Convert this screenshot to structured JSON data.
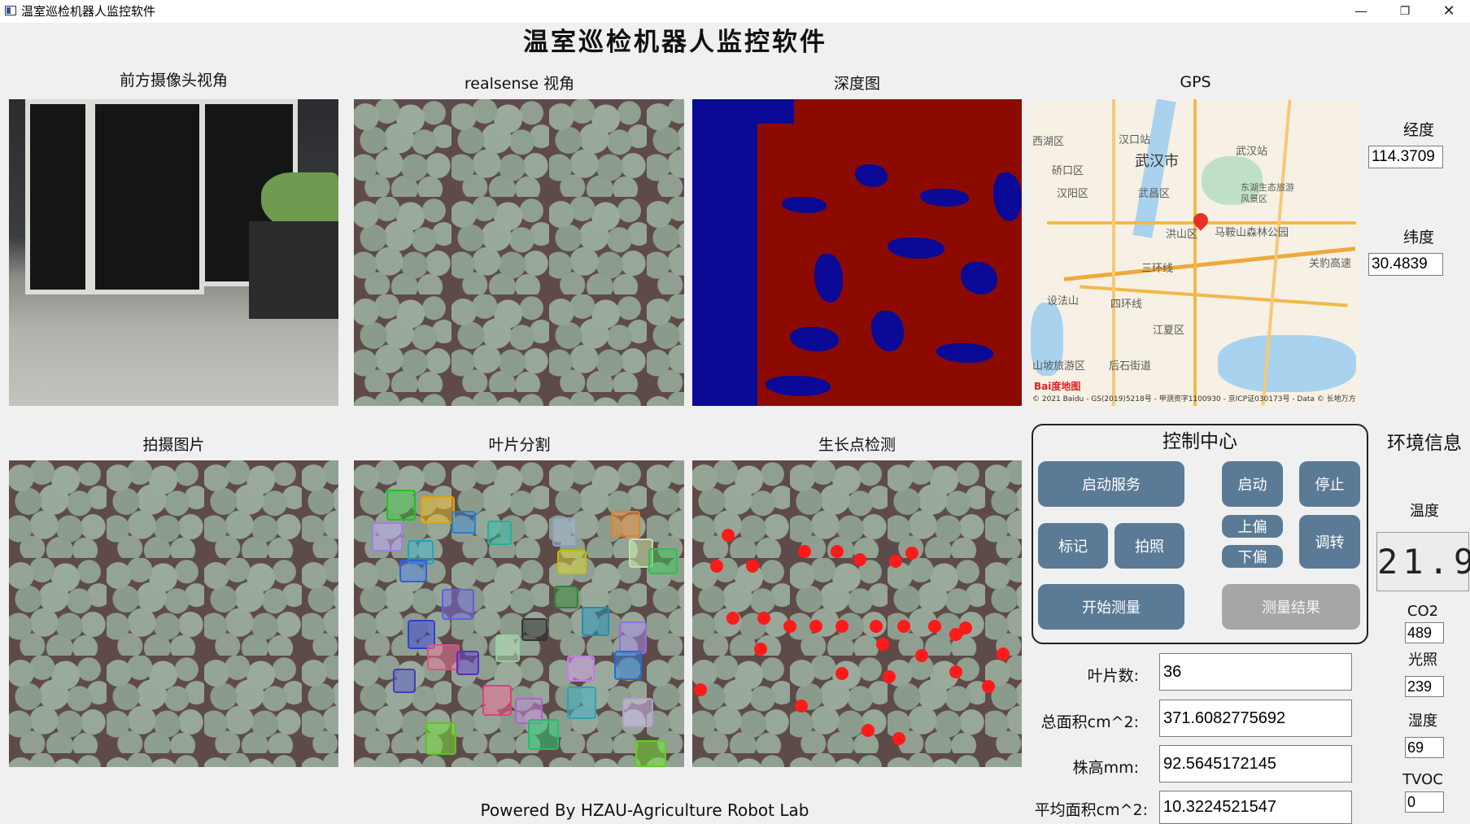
{
  "window": {
    "title": "温室巡检机器人监控软件",
    "minimize": "—",
    "maximize": "❐",
    "close": "✕"
  },
  "main_title": "温室巡检机器人监控软件",
  "views": {
    "front_camera": "前方摄像头视角",
    "realsense": "realsense 视角",
    "depth": "深度图",
    "gps": "GPS",
    "captured": "拍摄图片",
    "leaf_segmentation": "叶片分割",
    "growth_point": "生长点检测"
  },
  "map": {
    "city": "武汉市",
    "labels": [
      "西湖区",
      "汉口站",
      "硚口区",
      "汉阳区",
      "武昌区",
      "武汉站",
      "洪山区",
      "东湖生态旅游风景区",
      "马鞍山森林公园",
      "三环线",
      "四环线",
      "江夏区",
      "设法山",
      "关豹高速",
      "山坡旅游区",
      "后石街道"
    ],
    "copyright": "© 2021 Baidu - GS(2019)5218号 - 甲测资字1100930 - 京ICP证030173号 - Data © 长地万方",
    "logo": "Bai度地图"
  },
  "gps": {
    "longitude_label": "经度",
    "longitude_value": "114.3709",
    "latitude_label": "纬度",
    "latitude_value": "30.4839"
  },
  "control": {
    "title": "控制中心",
    "start_service": "启动服务",
    "start": "启动",
    "stop": "停止",
    "mark": "标记",
    "photo": "拍照",
    "up_offset": "上偏",
    "down_offset": "下偏",
    "adjust": "调转",
    "start_measure": "开始测量",
    "measure_result": "测量结果"
  },
  "measurements": {
    "leaf_count_label": "叶片数:",
    "leaf_count": "36",
    "total_area_label": "总面积cm^2:",
    "total_area": "371.6082775692",
    "plant_height_label": "株高mm:",
    "plant_height": "92.5645172145",
    "avg_area_label": "平均面积cm^2:",
    "avg_area": "10.3224521547"
  },
  "environment": {
    "title": "环境信息",
    "temperature_label": "温度",
    "temperature": "21.9",
    "co2_label": "CO2",
    "co2": "489",
    "light_label": "光照",
    "light": "239",
    "humidity_label": "湿度",
    "humidity": "69",
    "tvoc_label": "TVOC",
    "tvoc": "0"
  },
  "footer": "Powered By HZAU-Agriculture Robot Lab",
  "colors": {
    "button": "#5b7a95",
    "button_disabled": "#a6a6a6",
    "depth_red": "#8c0a00",
    "depth_blue": "#0a0a96",
    "growth_point": "#ff1a1a"
  }
}
